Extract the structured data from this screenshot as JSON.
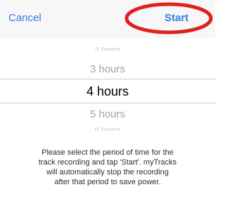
{
  "toolbar": {
    "cancel_label": "Cancel",
    "start_label": "Start",
    "accent_color": "#2f7ee0"
  },
  "annotation": {
    "shape": "ellipse",
    "color": "#e0201b",
    "target": "Start button"
  },
  "picker": {
    "options": [
      "2 hours",
      "3 hours",
      "4 hours",
      "5 hours",
      "6 hours"
    ],
    "selected_value": "4 hours"
  },
  "description": "Please select the period of time for the\ntrack recording and tap 'Start'. myTracks\nwill automatically stop the recording\nafter that period to save power."
}
